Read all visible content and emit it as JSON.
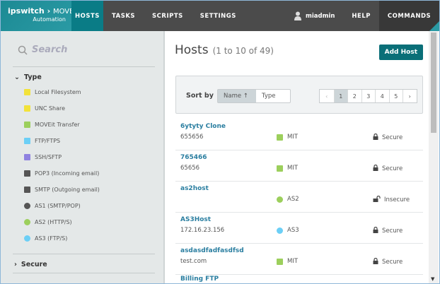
{
  "nav": {
    "logo_brand": "ipswitch",
    "logo_product": "MOVEit",
    "logo_sub": "Automation",
    "tabs": [
      "HOSTS",
      "TASKS",
      "SCRIPTS",
      "SETTINGS"
    ],
    "user": "miadmin",
    "help": "HELP",
    "commands": "COMMANDS"
  },
  "sidebar": {
    "search_placeholder": "Search",
    "type_label": "Type",
    "secure_label": "Secure",
    "filters": [
      {
        "label": "Local Filesystem",
        "color": "#f2e23a",
        "shape": "square"
      },
      {
        "label": "UNC Share",
        "color": "#f2e23a",
        "shape": "square"
      },
      {
        "label": "MOVEit Transfer",
        "color": "#9ccf5c",
        "shape": "square"
      },
      {
        "label": "FTP/FTPS",
        "color": "#6ccff6",
        "shape": "square"
      },
      {
        "label": "SSH/SFTP",
        "color": "#8f82e0",
        "shape": "square"
      },
      {
        "label": "POP3 (Incoming email)",
        "color": "#555555",
        "shape": "square"
      },
      {
        "label": "SMTP (Outgoing email)",
        "color": "#555555",
        "shape": "square"
      },
      {
        "label": "AS1 (SMTP/POP)",
        "color": "#555555",
        "shape": "circle"
      },
      {
        "label": "AS2 (HTTP/S)",
        "color": "#9ccf5c",
        "shape": "circle"
      },
      {
        "label": "AS3 (FTP/S)",
        "color": "#6ccff6",
        "shape": "circle"
      }
    ]
  },
  "main": {
    "title": "Hosts",
    "count": "(1 to 10 of 49)",
    "add_host": "Add Host",
    "sort_by": "Sort by",
    "sort_name": "Name",
    "sort_type": "Type",
    "pages": [
      "‹",
      "1",
      "2",
      "3",
      "4",
      "5",
      "›"
    ],
    "current_page": "1",
    "hosts": [
      {
        "name": "6ytyty Clone",
        "address": "655656",
        "type": "MIT",
        "type_color": "#9ccf5c",
        "shape": "square",
        "security": "Secure"
      },
      {
        "name": "765466",
        "address": "65656",
        "type": "MIT",
        "type_color": "#9ccf5c",
        "shape": "square",
        "security": "Secure"
      },
      {
        "name": "as2host",
        "address": "",
        "type": "AS2",
        "type_color": "#9ccf5c",
        "shape": "circle",
        "security": "Insecure"
      },
      {
        "name": "AS3Host",
        "address": "172.16.23.156",
        "type": "AS3",
        "type_color": "#6ccff6",
        "shape": "circle",
        "security": "Secure"
      },
      {
        "name": "asdasdfadfasdfsd",
        "address": "test.com",
        "type": "MIT",
        "type_color": "#9ccf5c",
        "shape": "square",
        "security": "Secure"
      },
      {
        "name": "Billing FTP",
        "address": "",
        "type": "",
        "type_color": "",
        "shape": "",
        "security": ""
      }
    ]
  }
}
